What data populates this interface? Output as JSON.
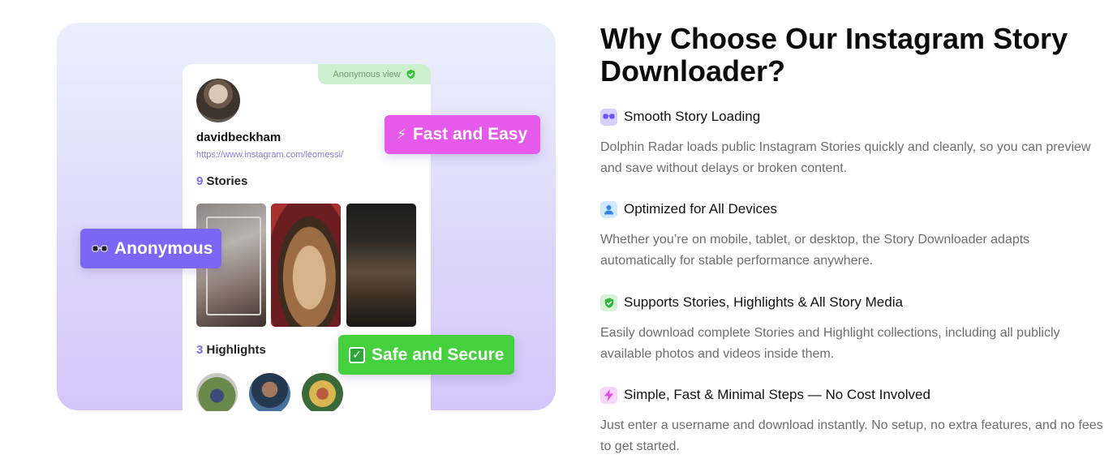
{
  "illustration": {
    "anonymous_view": "Anonymous view",
    "username": "davidbeckham",
    "link": "https://www.instagram.com/leomessi/",
    "stories_count": "9",
    "stories_label": " Stories",
    "highlights_count": "3",
    "highlights_label": " Highlights",
    "badges": {
      "fast": "Fast and Easy",
      "anonymous": "Anonymous",
      "safe": "Safe and Secure"
    }
  },
  "title": "Why Choose Our Instagram Story Downloader?",
  "features": [
    {
      "icon": "glasses-icon",
      "heading": "Smooth Story Loading",
      "description": "Dolphin Radar loads public Instagram Stories quickly and cleanly, so you can preview and save without delays or broken content."
    },
    {
      "icon": "user-icon",
      "heading": "Optimized for All Devices",
      "description": "Whether you’re on mobile, tablet, or desktop, the Story Downloader adapts automatically for stable performance anywhere."
    },
    {
      "icon": "shield-check-icon",
      "heading": "Supports Stories, Highlights & All Story Media",
      "description": "Easily download complete Stories and Highlight collections, including all publicly available photos and videos inside them."
    },
    {
      "icon": "lightning-icon",
      "heading": "Simple, Fast & Minimal Steps — No Cost Involved",
      "description": "Just enter a username and download instantly. No setup, no extra features, and no fees to get started."
    }
  ],
  "colors": {
    "fast_badge": "#e55aea",
    "anonymous_badge": "#7b66f5",
    "safe_badge": "#45d13d",
    "accent": "#7a6df2"
  }
}
